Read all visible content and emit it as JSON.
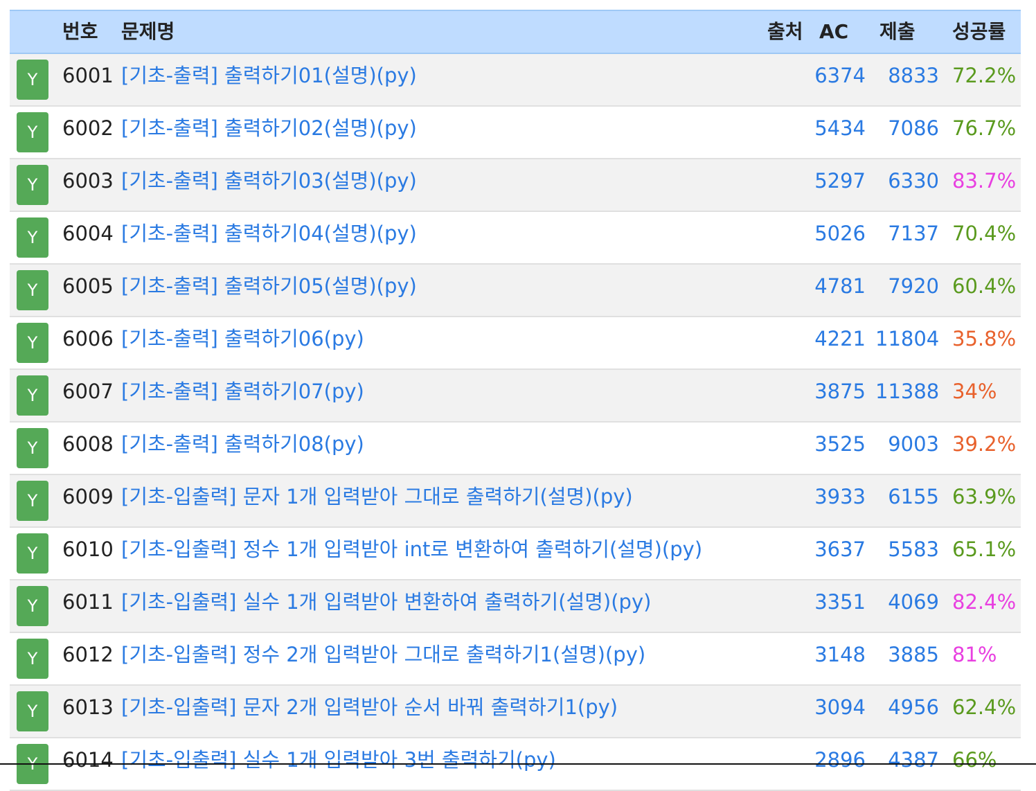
{
  "header": {
    "num": "번호",
    "title": "문제명",
    "source": "출처",
    "ac": "AC",
    "submit": "제출",
    "rate": "성공률"
  },
  "colors": {
    "header_bg": "#bfdcff",
    "badge_green": "#55a957",
    "link_blue": "#2a7ae2",
    "rate_green": "#5a9a1e",
    "rate_magenta": "#e83fe0",
    "rate_orange": "#e8612c"
  },
  "rows": [
    {
      "badge": "Y",
      "num": "6001",
      "title": "[기초-출력] 출력하기01(설명)(py)",
      "ac": "6374",
      "submit": "8833",
      "rate": "72.2%",
      "rate_color": "#5a9a1e"
    },
    {
      "badge": "Y",
      "num": "6002",
      "title": "[기초-출력] 출력하기02(설명)(py)",
      "ac": "5434",
      "submit": "7086",
      "rate": "76.7%",
      "rate_color": "#5a9a1e"
    },
    {
      "badge": "Y",
      "num": "6003",
      "title": "[기초-출력] 출력하기03(설명)(py)",
      "ac": "5297",
      "submit": "6330",
      "rate": "83.7%",
      "rate_color": "#e83fe0"
    },
    {
      "badge": "Y",
      "num": "6004",
      "title": "[기초-출력] 출력하기04(설명)(py)",
      "ac": "5026",
      "submit": "7137",
      "rate": "70.4%",
      "rate_color": "#5a9a1e"
    },
    {
      "badge": "Y",
      "num": "6005",
      "title": "[기초-출력] 출력하기05(설명)(py)",
      "ac": "4781",
      "submit": "7920",
      "rate": "60.4%",
      "rate_color": "#5a9a1e"
    },
    {
      "badge": "Y",
      "num": "6006",
      "title": "[기초-출력] 출력하기06(py)",
      "ac": "4221",
      "submit": "11804",
      "rate": "35.8%",
      "rate_color": "#e8612c"
    },
    {
      "badge": "Y",
      "num": "6007",
      "title": "[기초-출력] 출력하기07(py)",
      "ac": "3875",
      "submit": "11388",
      "rate": "34%",
      "rate_color": "#e8612c"
    },
    {
      "badge": "Y",
      "num": "6008",
      "title": "[기초-출력] 출력하기08(py)",
      "ac": "3525",
      "submit": "9003",
      "rate": "39.2%",
      "rate_color": "#e8612c"
    },
    {
      "badge": "Y",
      "num": "6009",
      "title": "[기초-입출력] 문자 1개 입력받아 그대로 출력하기(설명)(py)",
      "ac": "3933",
      "submit": "6155",
      "rate": "63.9%",
      "rate_color": "#5a9a1e"
    },
    {
      "badge": "Y",
      "num": "6010",
      "title": "[기초-입출력] 정수 1개 입력받아 int로 변환하여 출력하기(설명)(py)",
      "ac": "3637",
      "submit": "5583",
      "rate": "65.1%",
      "rate_color": "#5a9a1e"
    },
    {
      "badge": "Y",
      "num": "6011",
      "title": "[기초-입출력] 실수 1개 입력받아 변환하여 출력하기(설명)(py)",
      "ac": "3351",
      "submit": "4069",
      "rate": "82.4%",
      "rate_color": "#e83fe0"
    },
    {
      "badge": "Y",
      "num": "6012",
      "title": "[기초-입출력] 정수 2개 입력받아 그대로 출력하기1(설명)(py)",
      "ac": "3148",
      "submit": "3885",
      "rate": "81%",
      "rate_color": "#e83fe0"
    },
    {
      "badge": "Y",
      "num": "6013",
      "title": "[기초-입출력] 문자 2개 입력받아 순서 바꿔 출력하기1(py)",
      "ac": "3094",
      "submit": "4956",
      "rate": "62.4%",
      "rate_color": "#5a9a1e"
    },
    {
      "badge": "Y",
      "num": "6014",
      "title": "[기초-입출력] 실수 1개 입력받아 3번 출력하기(py)",
      "ac": "2896",
      "submit": "4387",
      "rate": "66%",
      "rate_color": "#5a9a1e"
    }
  ]
}
